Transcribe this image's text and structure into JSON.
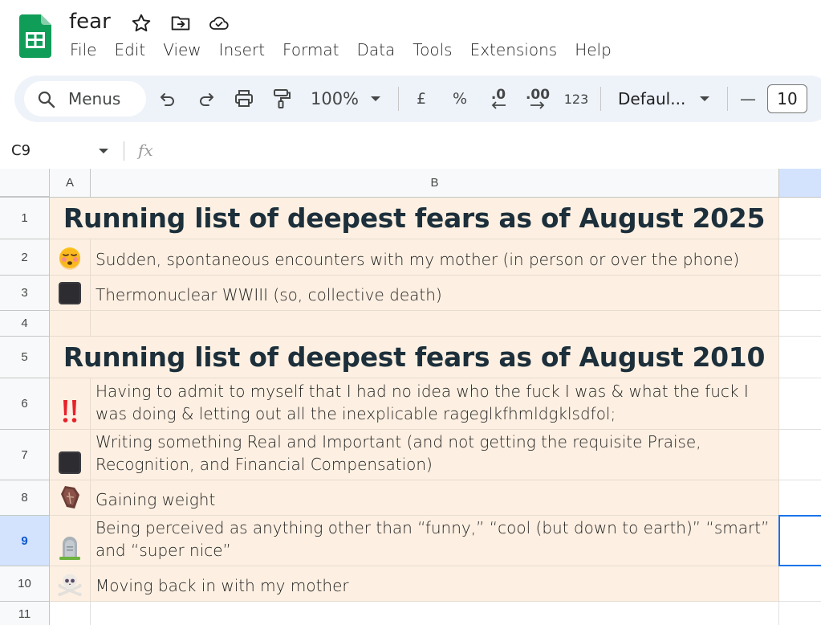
{
  "app": {
    "doc_title": "fear",
    "menus": [
      "File",
      "Edit",
      "View",
      "Insert",
      "Format",
      "Data",
      "Tools",
      "Extensions",
      "Help"
    ]
  },
  "toolbar": {
    "search_label": "Menus",
    "zoom": "100%",
    "currency": "£",
    "percent": "%",
    "decrease_decimal": ".0",
    "increase_decimal": ".00",
    "number_format": "123",
    "font": "Defaul...",
    "font_size": "10",
    "minus": "—"
  },
  "formula_bar": {
    "cell_ref": "C9",
    "fx": "fx"
  },
  "columns": [
    "A",
    "B"
  ],
  "rows": [
    {
      "num": "1",
      "type": "header",
      "text": "Running list of deepest fears as of August 2025"
    },
    {
      "num": "2",
      "type": "item",
      "icon": "tired-face-emoji-icon",
      "text": "Sudden, spontaneous encounters with my mother (in person or over the phone)"
    },
    {
      "num": "3",
      "type": "item",
      "icon": "black-square-icon",
      "text": "Thermonuclear WWIII (so, collective death)"
    },
    {
      "num": "4",
      "type": "empty",
      "text": ""
    },
    {
      "num": "5",
      "type": "header",
      "text": "Running list of deepest fears as of August 2010"
    },
    {
      "num": "6",
      "type": "item",
      "icon": "double-exclamation-icon",
      "text": "Having to admit to myself that I had no idea who the fuck I was & what the fuck I was doing & letting out all the inexplicable rageglkfhmldgklsdfol;"
    },
    {
      "num": "7",
      "type": "item",
      "icon": "black-square-icon",
      "text": "Writing something Real and Important (and not getting the requisite Praise, Recognition, and Financial Compensation)"
    },
    {
      "num": "8",
      "type": "item",
      "icon": "coffin-icon",
      "text": "Gaining weight"
    },
    {
      "num": "9",
      "type": "item",
      "icon": "headstone-icon",
      "text": "Being perceived as anything other than “funny,” “cool (but down to earth)” “smart” and “super nice”"
    },
    {
      "num": "10",
      "type": "item",
      "icon": "skull-crossbones-icon",
      "text": "Moving back in with my mother"
    },
    {
      "num": "11",
      "type": "blank",
      "text": ""
    }
  ],
  "colors": {
    "cell_fill": "#fdf0e2",
    "header_text": "#1c2f3b",
    "selection": "#1a73e8",
    "sheets_green": "#0f9d58"
  }
}
